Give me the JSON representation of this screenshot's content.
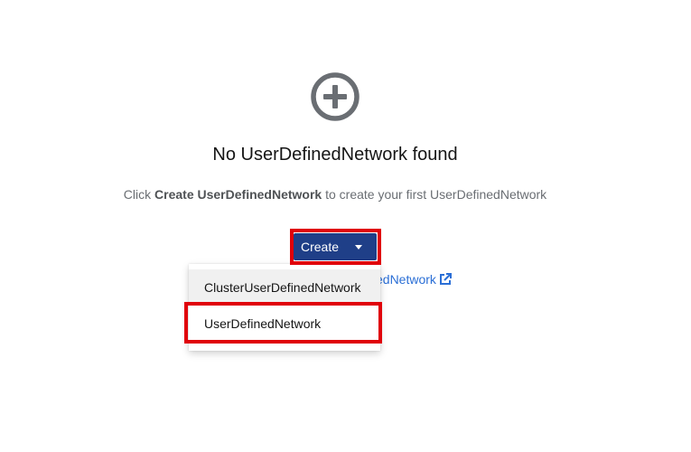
{
  "empty_state": {
    "icon": "add-circle-icon",
    "title": "No UserDefinedNetwork found",
    "body_prefix": "Click ",
    "body_strong": "Create UserDefinedNetwork",
    "body_suffix": " to create your first UserDefinedNetwork"
  },
  "create_button": {
    "label": "Create",
    "icon": "caret-down-icon",
    "color": "#1f3f88"
  },
  "doc_link": {
    "visible_text": "edNetwork",
    "icon": "external-link-icon",
    "color": "#2b6fd6"
  },
  "dropdown": {
    "items": [
      {
        "label": "ClusterUserDefinedNetwork"
      },
      {
        "label": "UserDefinedNetwork"
      }
    ]
  },
  "annotations": {
    "highlight_color": "#e0000a"
  }
}
